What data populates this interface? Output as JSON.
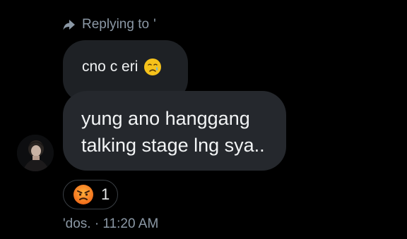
{
  "reply_header": {
    "label": "Replying to",
    "target": "'"
  },
  "quoted_message": {
    "text": "cno c eri",
    "emoji": "crying-face"
  },
  "message": {
    "line1": "yung ano hanggang",
    "line2": "talking stage lng sya.."
  },
  "reaction": {
    "emoji": "angry-face",
    "count": "1"
  },
  "meta": {
    "text": "'dos. · 11:20 AM"
  },
  "colors": {
    "background": "#000000",
    "bubble": "#25282d",
    "quoted_bubble": "#1e2125",
    "muted_text": "#8b98a5",
    "primary_text": "#f2f4f5"
  }
}
